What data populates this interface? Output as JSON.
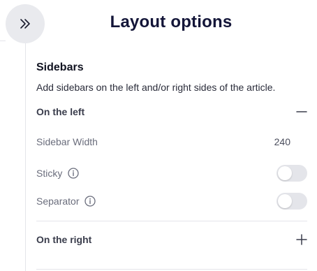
{
  "panel": {
    "title": "Layout options",
    "collapse_icon": "double-chevron-right-icon"
  },
  "sidebars": {
    "title": "Sidebars",
    "description": "Add sidebars on the left and/or right sides of the article.",
    "left": {
      "label": "On the left",
      "expanded": true,
      "toggle_icon": "minus-icon",
      "width_label": "Sidebar Width",
      "width_value": "240",
      "sticky_label": "Sticky",
      "sticky_enabled": false,
      "separator_label": "Separator",
      "separator_enabled": false
    },
    "right": {
      "label": "On the right",
      "expanded": false,
      "toggle_icon": "plus-icon"
    }
  },
  "colors": {
    "title": "#131538",
    "toggle_off": "#e4e5ea",
    "collapse_button_bg": "#e9eaee"
  }
}
